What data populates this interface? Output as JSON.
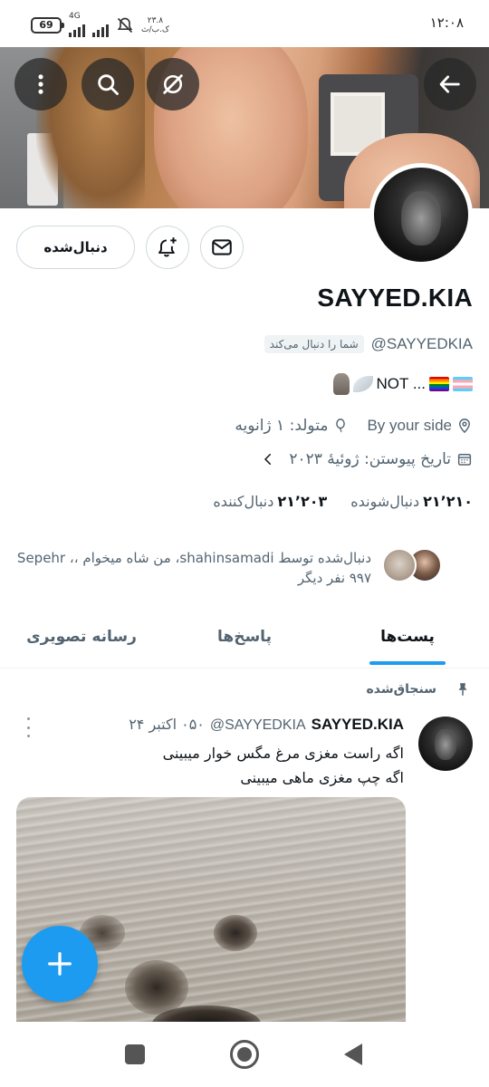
{
  "status_bar": {
    "time": "۱۲:۰۸",
    "battery": "69",
    "network": "4G",
    "speed_value": "۲۳.۸",
    "speed_unit": "ک.ب/ث"
  },
  "profile": {
    "display_name": "SAYYED.KIA",
    "handle": "@SAYYEDKIA",
    "follows_you": "شما را دنبال می‌کند",
    "bio_text": "NOT ...",
    "location": "By your side",
    "birthday": "متولد: ۱ ژانویه",
    "joined": "تاریخ پیوستن: ژوئیهٔ ۲۰۲۳",
    "following_count": "۲۱٬۲۰۳",
    "following_label": "دنبال‌کننده",
    "followers_count": "۲۱٬۲۱۰",
    "followers_label": "دنبال‌شونده",
    "followed_by_line1": "دنبال‌شده توسط shahinsamadi، من شاه میخوام ،، Sepehr",
    "followed_by_line2": "۹۹۷ نفر دیگر"
  },
  "actions": {
    "follow_label": "دنبال‌شده"
  },
  "tabs": [
    {
      "label": "پست‌ها",
      "active": true
    },
    {
      "label": "پاسخ‌ها",
      "active": false
    },
    {
      "label": "رسانه تصویری",
      "active": false
    }
  ],
  "pinned_label": "سنجاق‌شده",
  "tweet": {
    "name": "SAYYED.KIA",
    "handle": "@SAYYEDKIA",
    "time": "۰۵۰ اکتبر ۲۴",
    "line1": "اگه راست مغزی مرغ مگس خوار میبینی",
    "line2": "اگه چپ مغزی ماهی میبینی"
  },
  "colors": {
    "accent": "#1d9bf0",
    "text_primary": "#0f1419",
    "text_secondary": "#536471"
  }
}
